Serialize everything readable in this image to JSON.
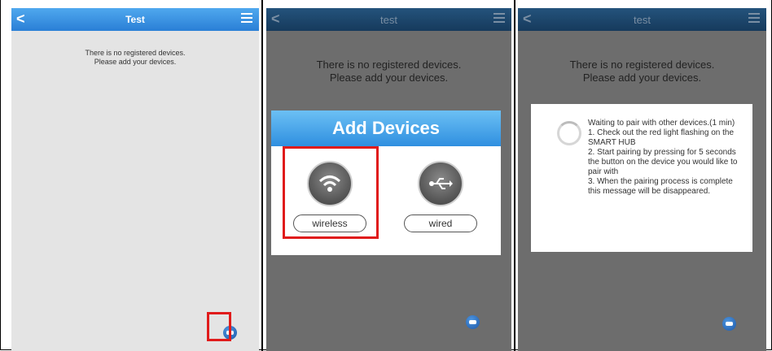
{
  "screen1": {
    "title": "Test",
    "message": "There is no registered devices.\nPlease add your devices."
  },
  "screen2": {
    "title": "test",
    "message": "There is no registered devices.\nPlease add your devices.",
    "dialog_title": "Add Devices",
    "options": [
      {
        "label": "wireless",
        "icon": "wifi-icon"
      },
      {
        "label": "wired",
        "icon": "usb-icon"
      }
    ]
  },
  "screen3": {
    "title": "test",
    "message": "There is no registered devices.\nPlease add your devices.",
    "pair_text": "Waiting to pair with other devices.(1 min)\n  1. Check out the red light flashing on the SMART HUB\n  2. Start pairing by pressing for 5 seconds the button on the device you would like to pair with\n  3. When the pairing process is complete this message will be disappeared."
  },
  "colors": {
    "highlight": "#e01b1b",
    "header_blue": "#2f8fe0",
    "fab_blue": "#1c57a8"
  }
}
